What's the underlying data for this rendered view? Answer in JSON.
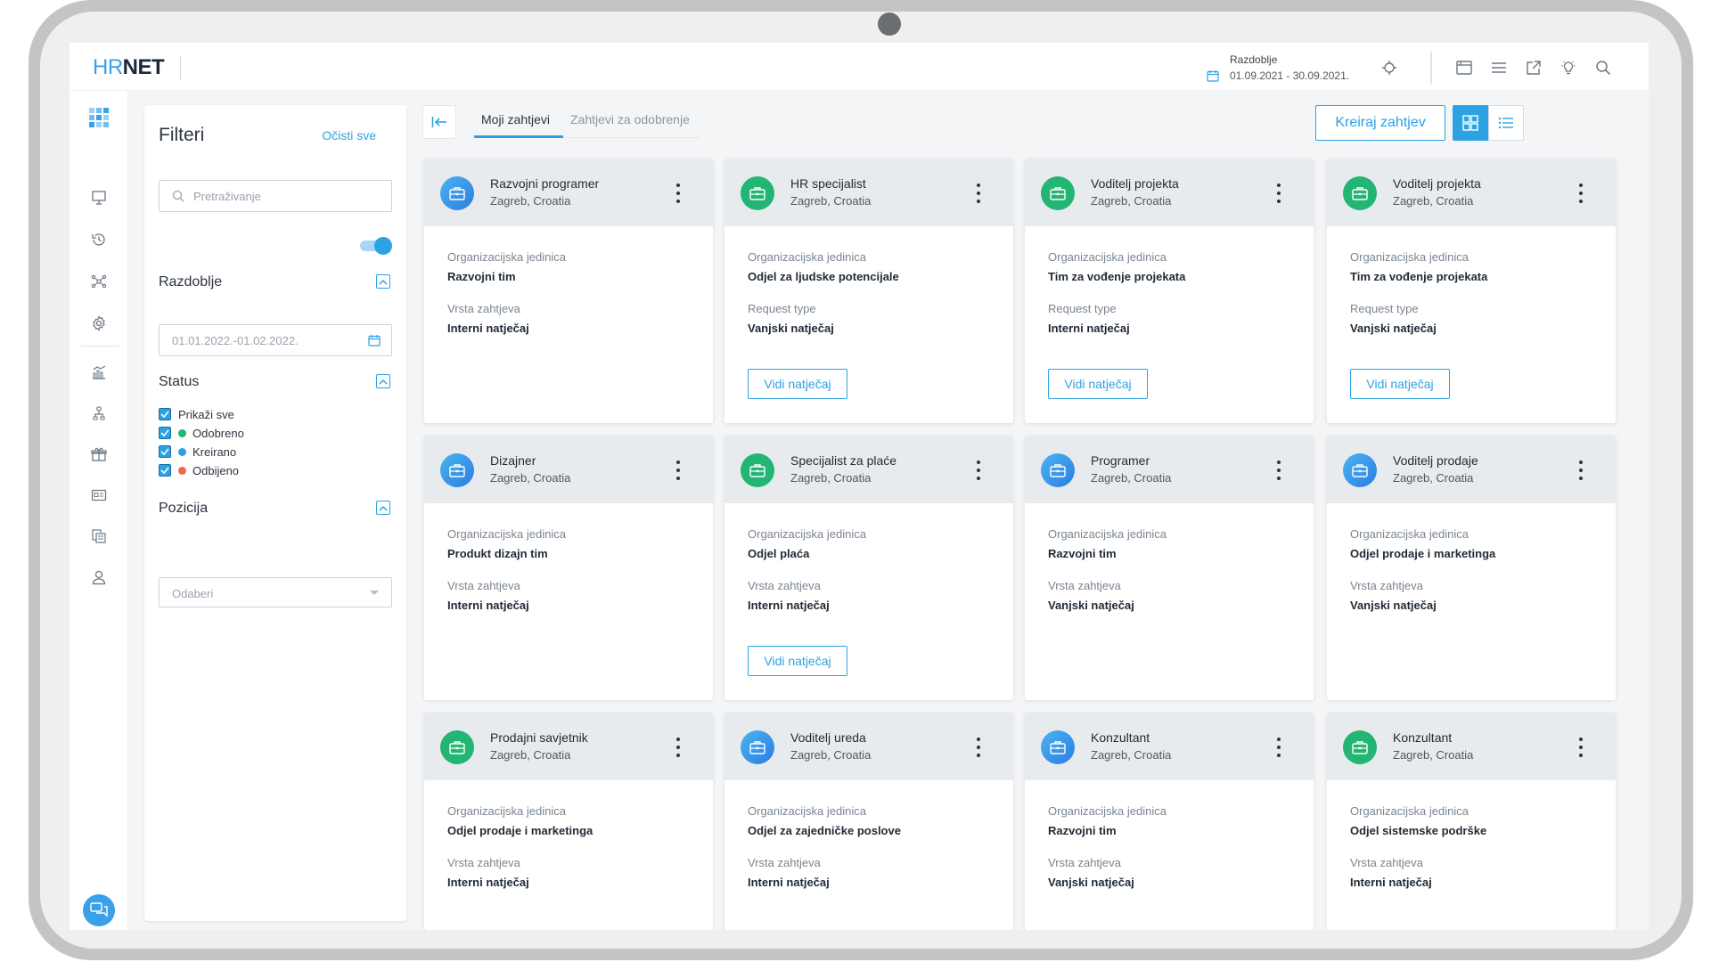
{
  "app": {
    "logo_prefix": "HR",
    "logo_suffix": "NET"
  },
  "header": {
    "period_label": "Razdoblje",
    "period_value": "01.09.2021 - 30.09.2021."
  },
  "filters": {
    "title": "Filteri",
    "clear_label": "Očisti sve",
    "search_placeholder": "Pretraživanje",
    "toggle_on": true,
    "period_title": "Razdoblje",
    "period_value": "01.01.2022.-01.02.2022.",
    "status_title": "Status",
    "status_options": [
      {
        "label": "Prikaži sve",
        "checked": true,
        "color": ""
      },
      {
        "label": "Odobreno",
        "checked": true,
        "color": "#22b573"
      },
      {
        "label": "Kreirano",
        "checked": true,
        "color": "#2da2e3"
      },
      {
        "label": "Odbijeno",
        "checked": true,
        "color": "#ef6a4c"
      }
    ],
    "position_title": "Pozicija",
    "position_placeholder": "Odaberi"
  },
  "tabs": [
    {
      "label": "Moji zahtjevi",
      "active": true
    },
    {
      "label": "Zahtjevi za odobrenje",
      "active": false
    }
  ],
  "create_button": "Kreiraj zahtjev",
  "cards": [
    {
      "title": "Razvojni programer",
      "location": "Zagreb, Croatia",
      "color": "blue",
      "org_label": "Organizacijska jedinica",
      "org": "Razvojni tim",
      "type_label": "Vrsta zahtjeva",
      "type": "Interni natječaj",
      "button": ""
    },
    {
      "title": "HR specijalist",
      "location": "Zagreb, Croatia",
      "color": "green",
      "org_label": "Organizacijska jedinica",
      "org": "Odjel za ljudske potencijale",
      "type_label": "Request type",
      "type": "Vanjski natječaj",
      "button": "Vidi natječaj"
    },
    {
      "title": "Voditelj projekta",
      "location": "Zagreb, Croatia",
      "color": "green",
      "org_label": "Organizacijska jedinica",
      "org": "Tim za vođenje projekata",
      "type_label": "Request type",
      "type": "Interni natječaj",
      "button": "Vidi natječaj"
    },
    {
      "title": "Voditelj projekta",
      "location": "Zagreb, Croatia",
      "color": "green",
      "org_label": "Organizacijska jedinica",
      "org": "Tim za vođenje projekata",
      "type_label": "Request type",
      "type": "Vanjski natječaj",
      "button": "Vidi natječaj"
    },
    {
      "title": "Dizajner",
      "location": "Zagreb, Croatia",
      "color": "blue",
      "org_label": "Organizacijska jedinica",
      "org": "Produkt dizajn tim",
      "type_label": "Vrsta zahtjeva",
      "type": "Interni natječaj",
      "button": ""
    },
    {
      "title": "Specijalist za plaće",
      "location": "Zagreb, Croatia",
      "color": "green",
      "org_label": "Organizacijska jedinica",
      "org": "Odjel plaća",
      "type_label": "Vrsta zahtjeva",
      "type": "Interni natječaj",
      "button": "Vidi natječaj"
    },
    {
      "title": "Programer",
      "location": "Zagreb, Croatia",
      "color": "blue",
      "org_label": "Organizacijska jedinica",
      "org": "Razvojni tim",
      "type_label": "Vrsta zahtjeva",
      "type": "Vanjski natječaj",
      "button": ""
    },
    {
      "title": "Voditelj prodaje",
      "location": "Zagreb, Croatia",
      "color": "blue",
      "org_label": "Organizacijska jedinica",
      "org": "Odjel prodaje i marketinga",
      "type_label": "Vrsta zahtjeva",
      "type": "Vanjski natječaj",
      "button": ""
    },
    {
      "title": "Prodajni savjetnik",
      "location": "Zagreb, Croatia",
      "color": "green",
      "org_label": "Organizacijska jedinica",
      "org": "Odjel prodaje i marketinga",
      "type_label": "Vrsta zahtjeva",
      "type": "Interni natječaj",
      "button": ""
    },
    {
      "title": "Voditelj ureda",
      "location": "Zagreb, Croatia",
      "color": "blue",
      "org_label": "Organizacijska jedinica",
      "org": "Odjel za zajedničke poslove",
      "type_label": "Vrsta zahtjeva",
      "type": "Interni natječaj",
      "button": ""
    },
    {
      "title": "Konzultant",
      "location": "Zagreb, Croatia",
      "color": "blue",
      "org_label": "Organizacijska jedinica",
      "org": "Razvojni tim",
      "type_label": "Vrsta zahtjeva",
      "type": "Vanjski natječaj",
      "button": ""
    },
    {
      "title": "Konzultant",
      "location": "Zagreb, Croatia",
      "color": "green",
      "org_label": "Organizacijska jedinica",
      "org": "Odjel sistemske podrške",
      "type_label": "Vrsta zahtjeva",
      "type": "Interni natječaj",
      "button": ""
    }
  ]
}
